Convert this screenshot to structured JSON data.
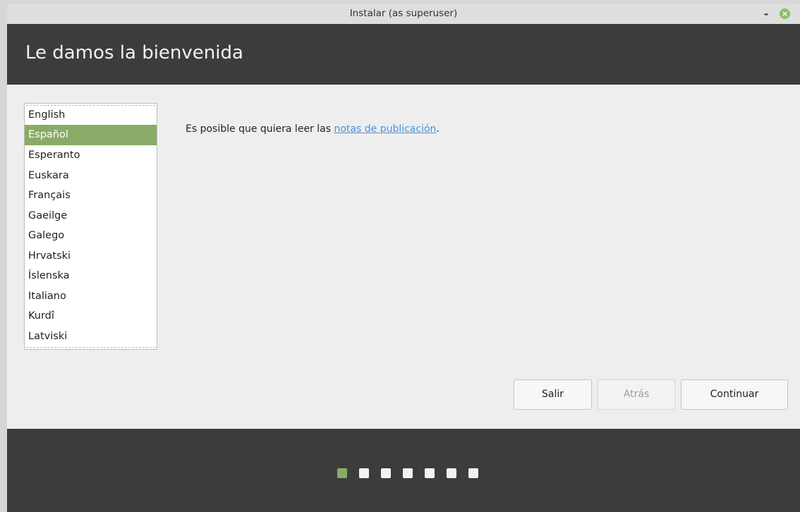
{
  "window": {
    "title": "Instalar (as superuser)",
    "minimize_glyph": "-",
    "close_glyph": "×"
  },
  "header": {
    "title": "Le damos la bienvenida"
  },
  "languages": {
    "items": [
      "English",
      "Español",
      "Esperanto",
      "Euskara",
      "Français",
      "Gaeilge",
      "Galego",
      "Hrvatski",
      "Íslenska",
      "Italiano",
      "Kurdî",
      "Latviski"
    ],
    "selected": "Español"
  },
  "notice": {
    "prefix": "Es posible que quiera leer las ",
    "link": "notas de publicación",
    "suffix": "."
  },
  "buttons": {
    "quit": "Salir",
    "back": "Atrás",
    "continue": "Continuar"
  },
  "progress": {
    "total_steps": 7,
    "current_step": 1
  },
  "colors": {
    "accent": "#8aab67",
    "header_bg": "#3c3c3c",
    "link": "#4a90d9"
  }
}
